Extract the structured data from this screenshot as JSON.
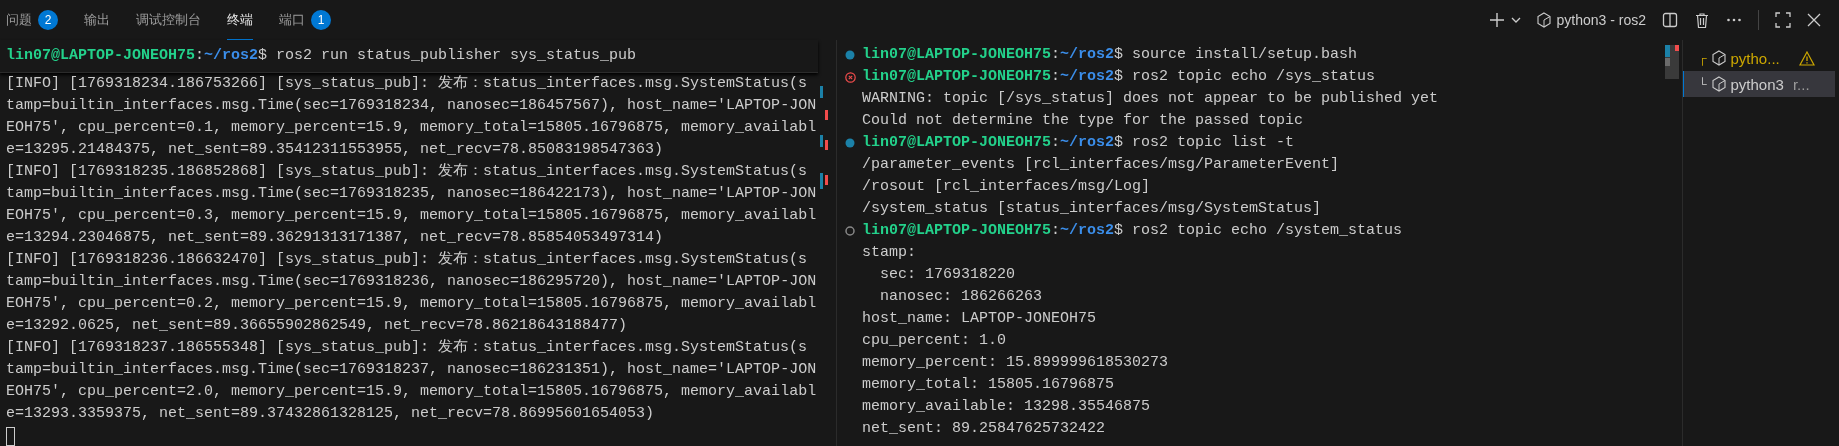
{
  "panel_tabs": [
    {
      "label": "问题",
      "badge": "2",
      "selected": false
    },
    {
      "label": "输出",
      "selected": false
    },
    {
      "label": "调试控制台",
      "selected": false
    },
    {
      "label": "终端",
      "selected": true
    },
    {
      "label": "端口",
      "badge": "1",
      "selected": false
    }
  ],
  "toolbar": {
    "active_terminal": "python3 - ros2"
  },
  "left_terminal": {
    "sticky_prompt": {
      "user": "lin07@LAPTOP-JONEOH75",
      "colon": ":",
      "path": "~/ros2",
      "dollar": "$",
      "command": " ros2 run status_publisher sys_status_pub"
    },
    "lines": [
      "[INFO] [1769318234.186753266] [sys_status_pub]: 发布：status_interfaces.msg.SystemStatus(s",
      "tamp=builtin_interfaces.msg.Time(sec=1769318234, nanosec=186457567), host_name='LAPTOP-JON",
      "EOH75', cpu_percent=0.1, memory_percent=15.9, memory_total=15805.16796875, memory_availabl",
      "e=13295.21484375, net_sent=89.35412311553955, net_recv=78.85083198547363)",
      "[INFO] [1769318235.186852868] [sys_status_pub]: 发布：status_interfaces.msg.SystemStatus(s",
      "tamp=builtin_interfaces.msg.Time(sec=1769318235, nanosec=186422173), host_name='LAPTOP-JON",
      "EOH75', cpu_percent=0.3, memory_percent=15.9, memory_total=15805.16796875, memory_availabl",
      "e=13294.23046875, net_sent=89.36291313171387, net_recv=78.85854053497314)",
      "[INFO] [1769318236.186632470] [sys_status_pub]: 发布：status_interfaces.msg.SystemStatus(s",
      "tamp=builtin_interfaces.msg.Time(sec=1769318236, nanosec=186295720), host_name='LAPTOP-JON",
      "EOH75', cpu_percent=0.2, memory_percent=15.9, memory_total=15805.16796875, memory_availabl",
      "e=13292.0625, net_sent=89.36655902862549, net_recv=78.86218643188477)",
      "[INFO] [1769318237.186555348] [sys_status_pub]: 发布：status_interfaces.msg.SystemStatus(s",
      "tamp=builtin_interfaces.msg.Time(sec=1769318237, nanosec=186231351), host_name='LAPTOP-JON",
      "EOH75', cpu_percent=2.0, memory_percent=15.9, memory_total=15805.16796875, memory_availabl",
      "e=13293.3359375, net_sent=89.37432861328125, net_recv=78.86995601654053)"
    ]
  },
  "right_terminal": {
    "lines": [
      {
        "kind": "prompt",
        "failed": false,
        "running": false,
        "user": "lin07@LAPTOP-JONEOH75",
        "colon": ":",
        "path": "~/ros2",
        "dollar": "$",
        "command": " source install/setup.bash"
      },
      {
        "kind": "prompt",
        "failed": true,
        "running": false,
        "user": "lin07@LAPTOP-JONEOH75",
        "colon": ":",
        "path": "~/ros2",
        "dollar": "$",
        "command": " ros2 topic echo /sys_status"
      },
      {
        "kind": "output",
        "text": "WARNING: topic [/sys_status] does not appear to be published yet"
      },
      {
        "kind": "output",
        "text": "Could not determine the type for the passed topic"
      },
      {
        "kind": "prompt",
        "failed": false,
        "running": false,
        "user": "lin07@LAPTOP-JONEOH75",
        "colon": ":",
        "path": "~/ros2",
        "dollar": "$",
        "command": " ros2 topic list -t"
      },
      {
        "kind": "output",
        "text": "/parameter_events [rcl_interfaces/msg/ParameterEvent]"
      },
      {
        "kind": "output",
        "text": "/rosout [rcl_interfaces/msg/Log]"
      },
      {
        "kind": "output",
        "text": "/system_status [status_interfaces/msg/SystemStatus]"
      },
      {
        "kind": "prompt",
        "failed": false,
        "running": true,
        "user": "lin07@LAPTOP-JONEOH75",
        "colon": ":",
        "path": "~/ros2",
        "dollar": "$",
        "command": " ros2 topic echo /system_status"
      },
      {
        "kind": "output",
        "text": "stamp:"
      },
      {
        "kind": "output",
        "text": "  sec: 1769318220"
      },
      {
        "kind": "output",
        "text": "  nanosec: 186266263"
      },
      {
        "kind": "output",
        "text": "host_name: LAPTOP-JONEOH75"
      },
      {
        "kind": "output",
        "text": "cpu_percent: 1.0"
      },
      {
        "kind": "output",
        "text": "memory_percent: 15.899999618530273"
      },
      {
        "kind": "output",
        "text": "memory_total: 15805.16796875"
      },
      {
        "kind": "output",
        "text": "memory_available: 13298.35546875"
      },
      {
        "kind": "output",
        "text": "net_sent: 89.25847625732422"
      }
    ]
  },
  "terminal_list": [
    {
      "connector": "┌",
      "name": "pytho...",
      "warning": true,
      "selected": false
    },
    {
      "connector": "└",
      "name": "python3",
      "detail": "r...",
      "warning": false,
      "selected": true
    }
  ]
}
